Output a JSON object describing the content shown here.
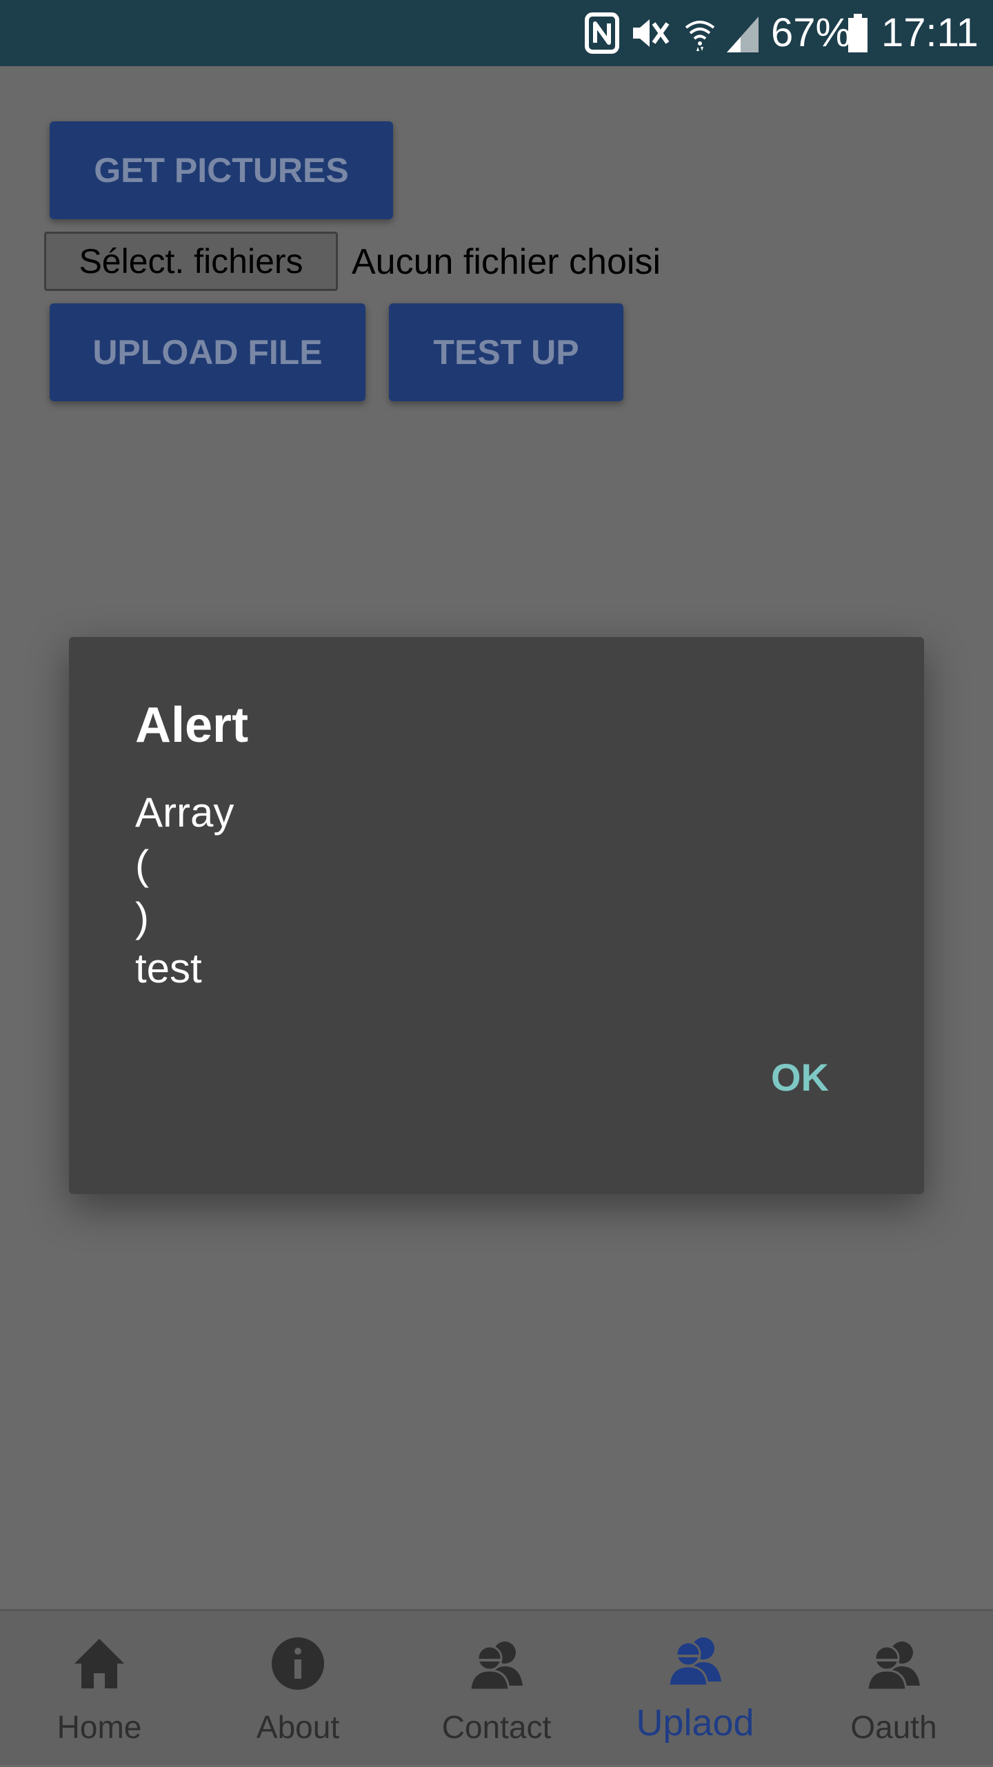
{
  "status_bar": {
    "battery": "67%",
    "time": "17:11",
    "icons": [
      "nfc-icon",
      "mute-icon",
      "wifi-icon",
      "signal-icon",
      "battery-icon"
    ]
  },
  "page": {
    "get_pictures_label": "GET PICTURES",
    "file_input_label": "Sélect. fichiers",
    "file_status": "Aucun fichier choisi",
    "upload_file_label": "UPLOAD FILE",
    "test_up_label": "TEST UP"
  },
  "dialog": {
    "title": "Alert",
    "lines": [
      "Array",
      "(",
      ")",
      "test"
    ],
    "ok_label": "OK"
  },
  "nav": {
    "items": [
      {
        "label": "Home",
        "icon": "home-icon"
      },
      {
        "label": "About",
        "icon": "info-icon"
      },
      {
        "label": "Contact",
        "icon": "contacts-icon"
      },
      {
        "label": "Uplaod",
        "icon": "contacts-icon"
      },
      {
        "label": "Oauth",
        "icon": "contacts-icon"
      }
    ],
    "active_index": 3
  },
  "colors": {
    "status_bar_bg": "#1d3e4b",
    "button_bg": "#1f3a72",
    "dialog_bg": "#434343",
    "dialog_ok": "#7ec9c5",
    "nav_active": "#1f3c86",
    "overlay_bg": "#6a6a6a"
  }
}
